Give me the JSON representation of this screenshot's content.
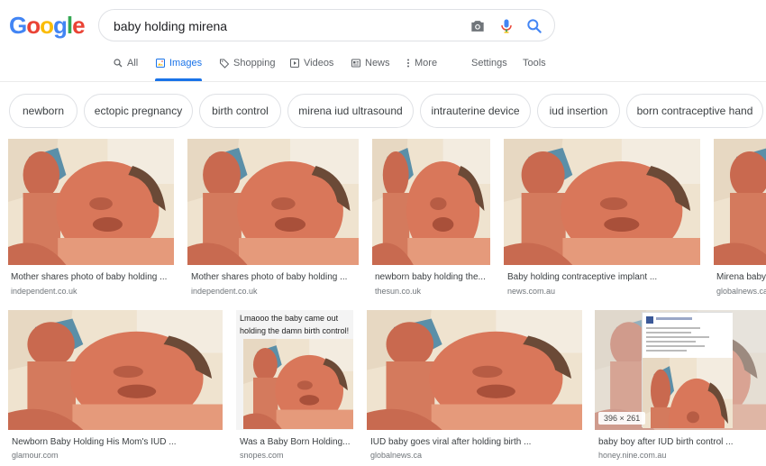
{
  "logo": {
    "text": "Google",
    "letters": [
      "G",
      "o",
      "o",
      "g",
      "l",
      "e"
    ],
    "colors": [
      "#4285F4",
      "#EA4335",
      "#FBBC05",
      "#4285F4",
      "#34A853",
      "#EA4335"
    ]
  },
  "search": {
    "value": "baby holding mirena",
    "placeholder": ""
  },
  "tabs": [
    {
      "label": "All",
      "icon": "search-icon"
    },
    {
      "label": "Images",
      "icon": "image-icon",
      "active": true
    },
    {
      "label": "Shopping",
      "icon": "tag-icon"
    },
    {
      "label": "Videos",
      "icon": "play-icon"
    },
    {
      "label": "News",
      "icon": "newspaper-icon"
    },
    {
      "label": "More",
      "icon": "more-vert-icon"
    },
    {
      "label": "Settings"
    },
    {
      "label": "Tools"
    }
  ],
  "chips": [
    "newborn",
    "ectopic pregnancy",
    "birth control",
    "mirena iud ultrasound",
    "intrauterine device",
    "iud insertion",
    "born contraceptive hand"
  ],
  "results_row1": [
    {
      "title": "Mother shares photo of baby holding ...",
      "source": "independent.co.uk"
    },
    {
      "title": "Mother shares photo of baby holding ...",
      "source": "independent.co.uk"
    },
    {
      "title": "newborn baby holding the...",
      "source": "thesun.co.uk"
    },
    {
      "title": "Baby holding contraceptive implant ...",
      "source": "news.com.au"
    },
    {
      "title": "Mirena baby",
      "source": "globalnews.ca"
    }
  ],
  "results_row2": [
    {
      "title": "Newborn Baby Holding His Mom's IUD ...",
      "source": "glamour.com"
    },
    {
      "title": "Was a Baby Born Holding...",
      "source": "snopes.com",
      "caption": "Lmaooo the baby came out holding the damn birth control!"
    },
    {
      "title": "IUD baby goes viral after holding birth ...",
      "source": "globalnews.ca"
    },
    {
      "title": "baby boy after IUD birth control ...",
      "source": "honey.nine.com.au",
      "dimensions": "396 × 261"
    }
  ],
  "colors": {
    "accent": "#1a73e8",
    "skin": "#d9775a",
    "blanket": "#efe3cf",
    "glove": "#5b8fa8"
  }
}
